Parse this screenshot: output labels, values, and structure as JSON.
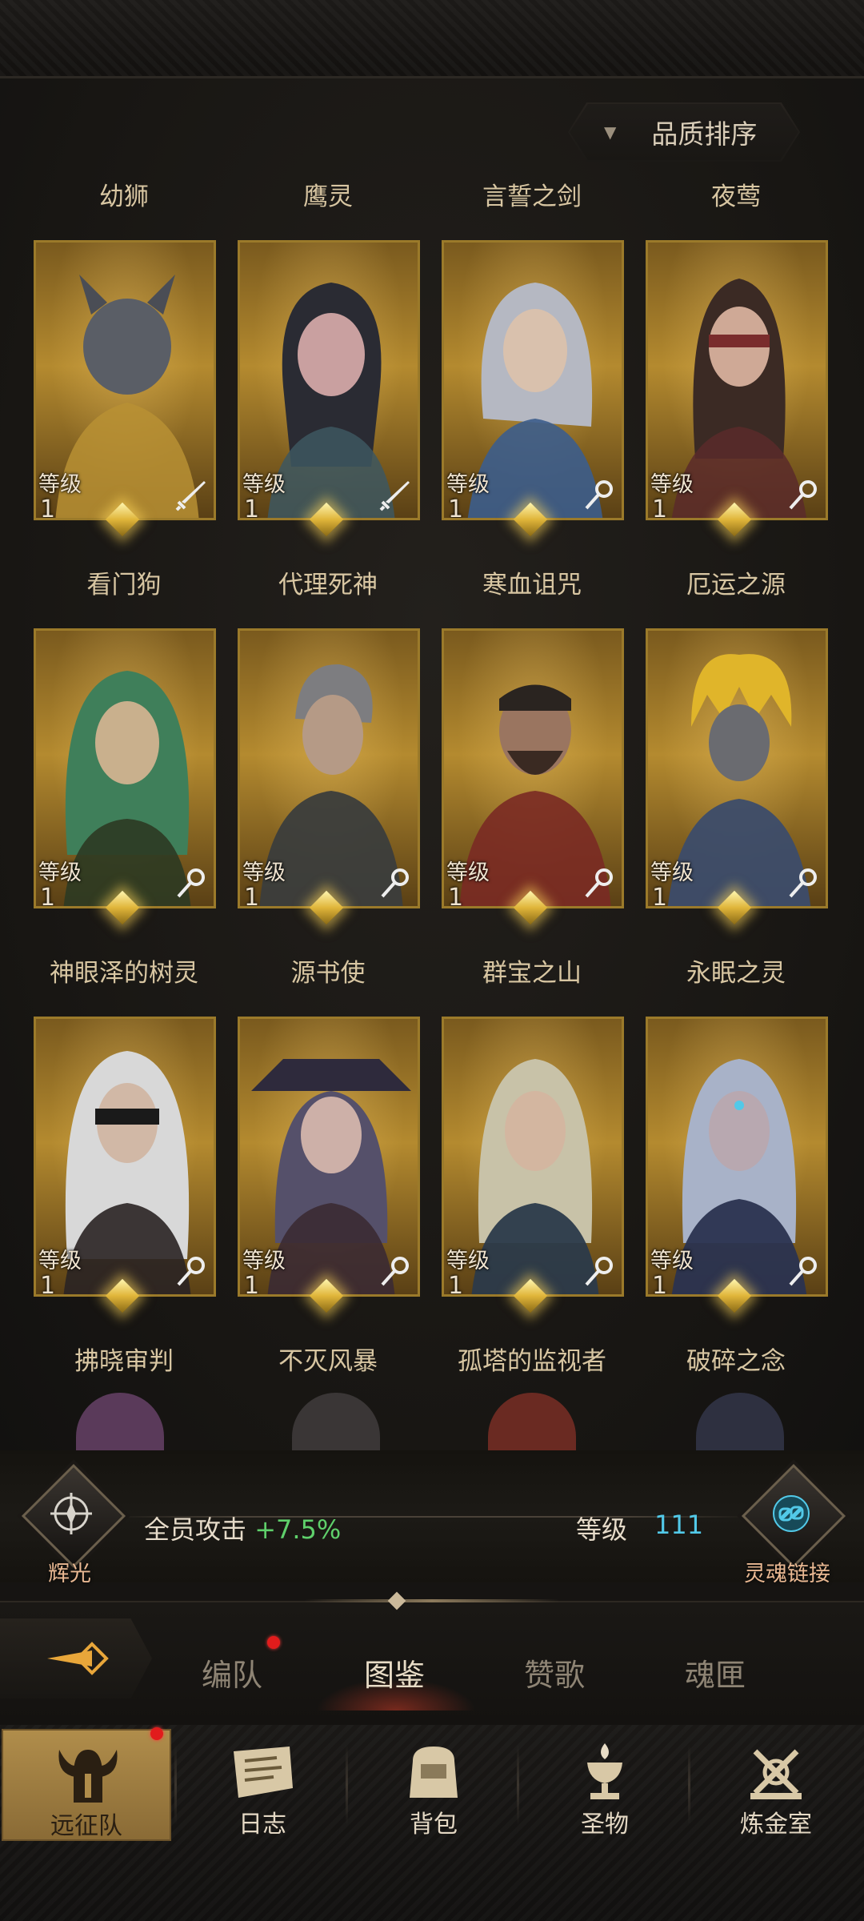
{
  "sort": {
    "label": "品质排序"
  },
  "heroes": [
    [
      {
        "name": "幼狮",
        "level_label": "等级",
        "level": "1",
        "type": "sword-icon",
        "colors": [
          "#5a5e66",
          "#b89034"
        ]
      },
      {
        "name": "鹰灵",
        "level_label": "等级",
        "level": "1",
        "type": "sword-icon",
        "colors": [
          "#2a2b33",
          "#c9a0a0"
        ]
      },
      {
        "name": "言誓之剑",
        "level_label": "等级",
        "level": "1",
        "type": "staff-icon",
        "colors": [
          "#b5b8c2",
          "#3c5d8c"
        ]
      },
      {
        "name": "夜莺",
        "level_label": "等级",
        "level": "1",
        "type": "staff-icon",
        "colors": [
          "#3b2a24",
          "#7a2c2c"
        ]
      }
    ],
    [
      {
        "name": "看门狗",
        "level_label": "等级",
        "level": "1",
        "type": "staff-icon",
        "colors": [
          "#3f7f5a",
          "#2c3a22"
        ]
      },
      {
        "name": "代理死神",
        "level_label": "等级",
        "level": "1",
        "type": "staff-icon",
        "colors": [
          "#7d7d80",
          "#3b3d3c"
        ]
      },
      {
        "name": "寒血诅咒",
        "level_label": "等级",
        "level": "1",
        "type": "staff-icon",
        "colors": [
          "#3a2a22",
          "#7a2a24"
        ]
      },
      {
        "name": "厄运之源",
        "level_label": "等级",
        "level": "1",
        "type": "staff-icon",
        "colors": [
          "#e0b52a",
          "#3c4c6a"
        ]
      }
    ],
    [
      {
        "name": "神眼泽的树灵",
        "level_label": "等级",
        "level": "1",
        "type": "staff-icon",
        "colors": [
          "#d8d8d8",
          "#2a2423"
        ]
      },
      {
        "name": "源书使",
        "level_label": "等级",
        "level": "1",
        "type": "staff-icon",
        "colors": [
          "#55506a",
          "#2e2a3c"
        ]
      },
      {
        "name": "群宝之山",
        "level_label": "等级",
        "level": "1",
        "type": "staff-icon",
        "colors": [
          "#c8c2a8",
          "#2b3a4a"
        ]
      },
      {
        "name": "永眠之灵",
        "level_label": "等级",
        "level": "1",
        "type": "staff-icon",
        "colors": [
          "#a8b2c8",
          "#2a3350"
        ]
      }
    ]
  ],
  "next_row_names": [
    "拂晓审判",
    "不灭风暴",
    "孤塔的监视者",
    "破碎之念"
  ],
  "bonus": {
    "left_emblem_label": "辉光",
    "text": "全员攻击",
    "value": "+7.5%",
    "level_label": "等级",
    "level_value": "111",
    "right_emblem_label": "灵魂链接"
  },
  "tabs": [
    {
      "label": "编队",
      "active": false,
      "badge": true
    },
    {
      "label": "图鉴",
      "active": true,
      "badge": false
    },
    {
      "label": "赞歌",
      "active": false,
      "badge": false
    },
    {
      "label": "魂匣",
      "active": false,
      "badge": false
    }
  ],
  "nav": [
    {
      "label": "远征队",
      "icon": "helmet-icon",
      "active": true,
      "badge": true
    },
    {
      "label": "日志",
      "icon": "scroll-icon",
      "active": false
    },
    {
      "label": "背包",
      "icon": "bag-icon",
      "active": false
    },
    {
      "label": "圣物",
      "icon": "chalice-icon",
      "active": false
    },
    {
      "label": "炼金室",
      "icon": "alchemy-icon",
      "active": false
    }
  ],
  "colors": {
    "gold": "#b48a2f",
    "accent_green": "#5fd06b",
    "accent_cyan": "#52c9e8",
    "badge_red": "#e11c1c"
  }
}
